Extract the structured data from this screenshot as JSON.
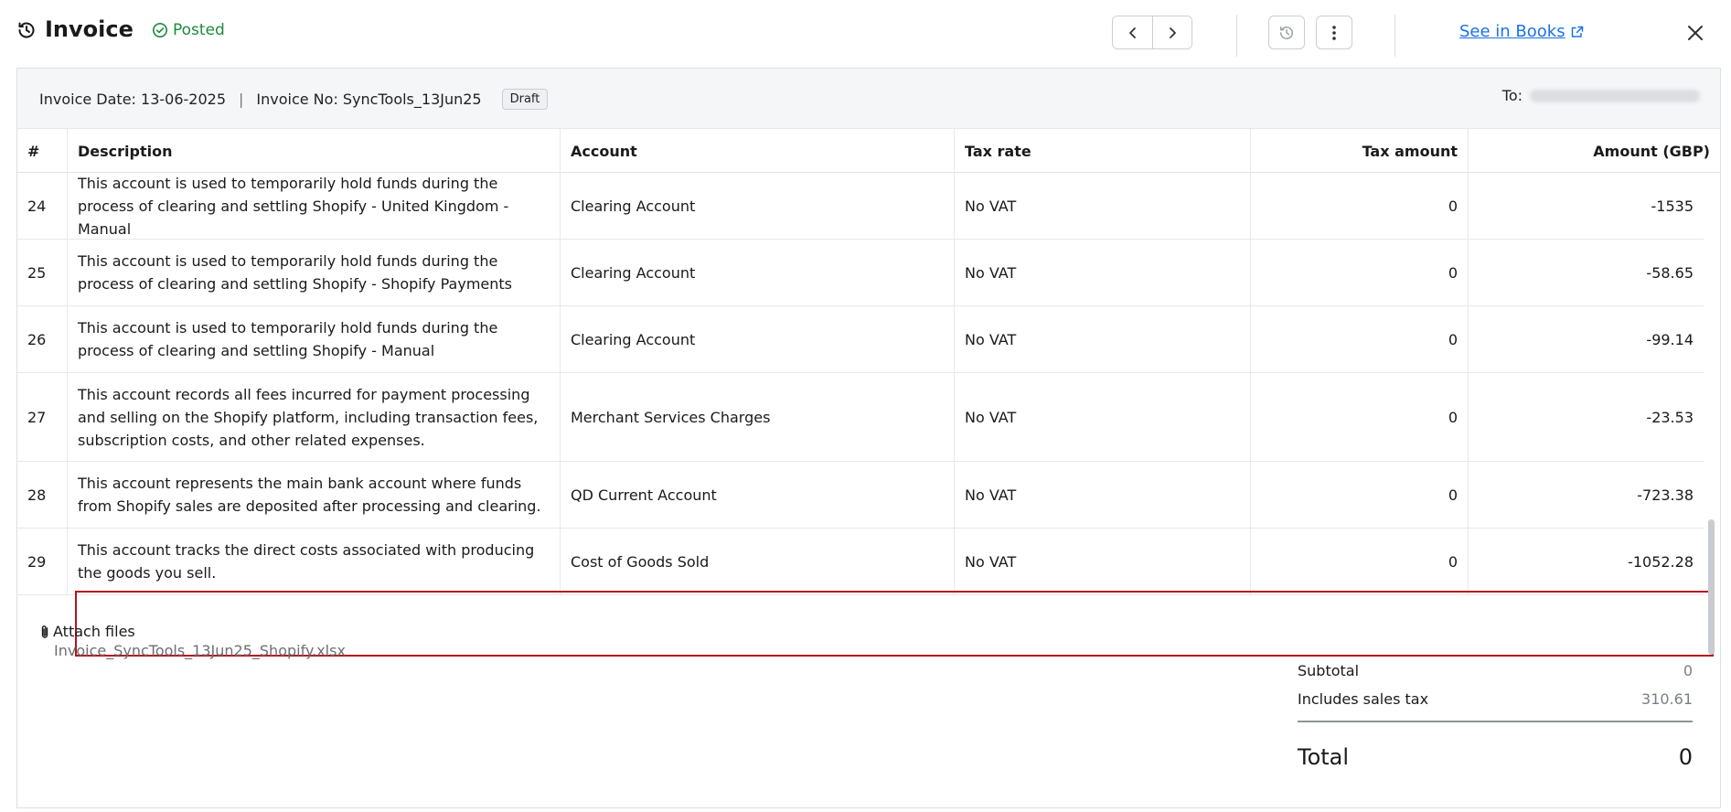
{
  "header": {
    "title": "Invoice",
    "status": "Posted",
    "see_in_books": "See in Books",
    "icons": {
      "title_icon": "history-icon",
      "status_icon": "check-circle-icon",
      "prev": "chevron-left-icon",
      "next": "chevron-right-icon",
      "history": "history-icon",
      "more": "more-vertical-icon",
      "external": "external-link-icon",
      "close": "close-icon"
    }
  },
  "meta": {
    "invoice_date": "Invoice Date: 13-06-2025",
    "separator": "|",
    "invoice_no": "Invoice No: SyncTools_13Jun25",
    "badge": "Draft",
    "to_label": "To:"
  },
  "table": {
    "columns": [
      "#",
      "Description",
      "Account",
      "Tax rate",
      "Tax amount",
      "Amount (GBP)"
    ],
    "rows": [
      {
        "num": "24",
        "description": "This account is used to temporarily hold funds during the process of clearing and settling Shopify - United Kingdom - Manual",
        "account": "Clearing Account",
        "tax_rate": "No VAT",
        "tax_amount": "0",
        "amount": "-1535"
      },
      {
        "num": "25",
        "description": "This account is used to temporarily hold funds during the process of clearing and settling Shopify - Shopify Payments",
        "account": "Clearing Account",
        "tax_rate": "No VAT",
        "tax_amount": "0",
        "amount": "-58.65"
      },
      {
        "num": "26",
        "description": "This account is used to temporarily hold funds during the process of clearing and settling Shopify - Manual",
        "account": "Clearing Account",
        "tax_rate": "No VAT",
        "tax_amount": "0",
        "amount": "-99.14"
      },
      {
        "num": "27",
        "description": "This account records all fees incurred for payment processing and selling on the Shopify platform, including transaction fees, subscription costs, and other related expenses.",
        "account": "Merchant Services Charges",
        "tax_rate": "No VAT",
        "tax_amount": "0",
        "amount": "-23.53"
      },
      {
        "num": "28",
        "description": "This account represents the main bank account where funds from Shopify sales are deposited after processing and clearing.",
        "account": "QD Current Account",
        "tax_rate": "No VAT",
        "tax_amount": "0",
        "amount": "-723.38"
      },
      {
        "num": "29",
        "description": "This account tracks the direct costs associated with producing the goods you sell.",
        "account": "Cost of Goods Sold",
        "tax_rate": "No VAT",
        "tax_amount": "0",
        "amount": "-1052.28"
      }
    ]
  },
  "footer": {
    "attach_label": "Attach files",
    "attach_icon": "paperclip-icon",
    "file_name": "Invoice_SyncTools_13Jun25_Shopify.xlsx",
    "subtotal_label": "Subtotal",
    "subtotal_value": "0",
    "sales_tax_label": "Includes sales tax",
    "sales_tax_value": "310.61",
    "total_label": "Total",
    "total_value": "0"
  },
  "colors": {
    "status_green": "#1e8a3c",
    "link_blue": "#1a73e8",
    "highlight_red": "#b3141f"
  }
}
